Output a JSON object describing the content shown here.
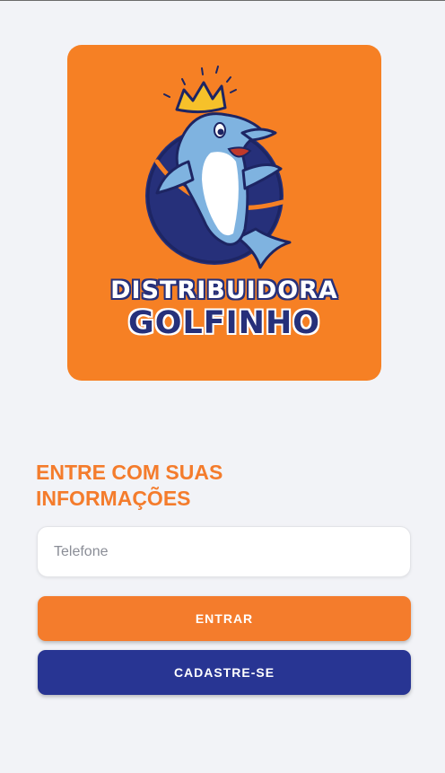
{
  "logo": {
    "line1": "DISTRIBUIDORA",
    "line2": "GOLFINHO",
    "background_color": "#f68024",
    "circle_color": "#26307a",
    "dolphin_color": "#7fb3e0",
    "crown_color": "#f6c12a"
  },
  "login": {
    "heading": "ENTRE COM SUAS INFORMAÇÕES",
    "phone_placeholder": "Telefone",
    "phone_value": "",
    "enter_label": "ENTRAR",
    "register_label": "CADASTRE-SE"
  },
  "colors": {
    "page_background": "#f2f3f7",
    "accent_orange": "#f47c2c",
    "accent_blue": "#283593"
  }
}
